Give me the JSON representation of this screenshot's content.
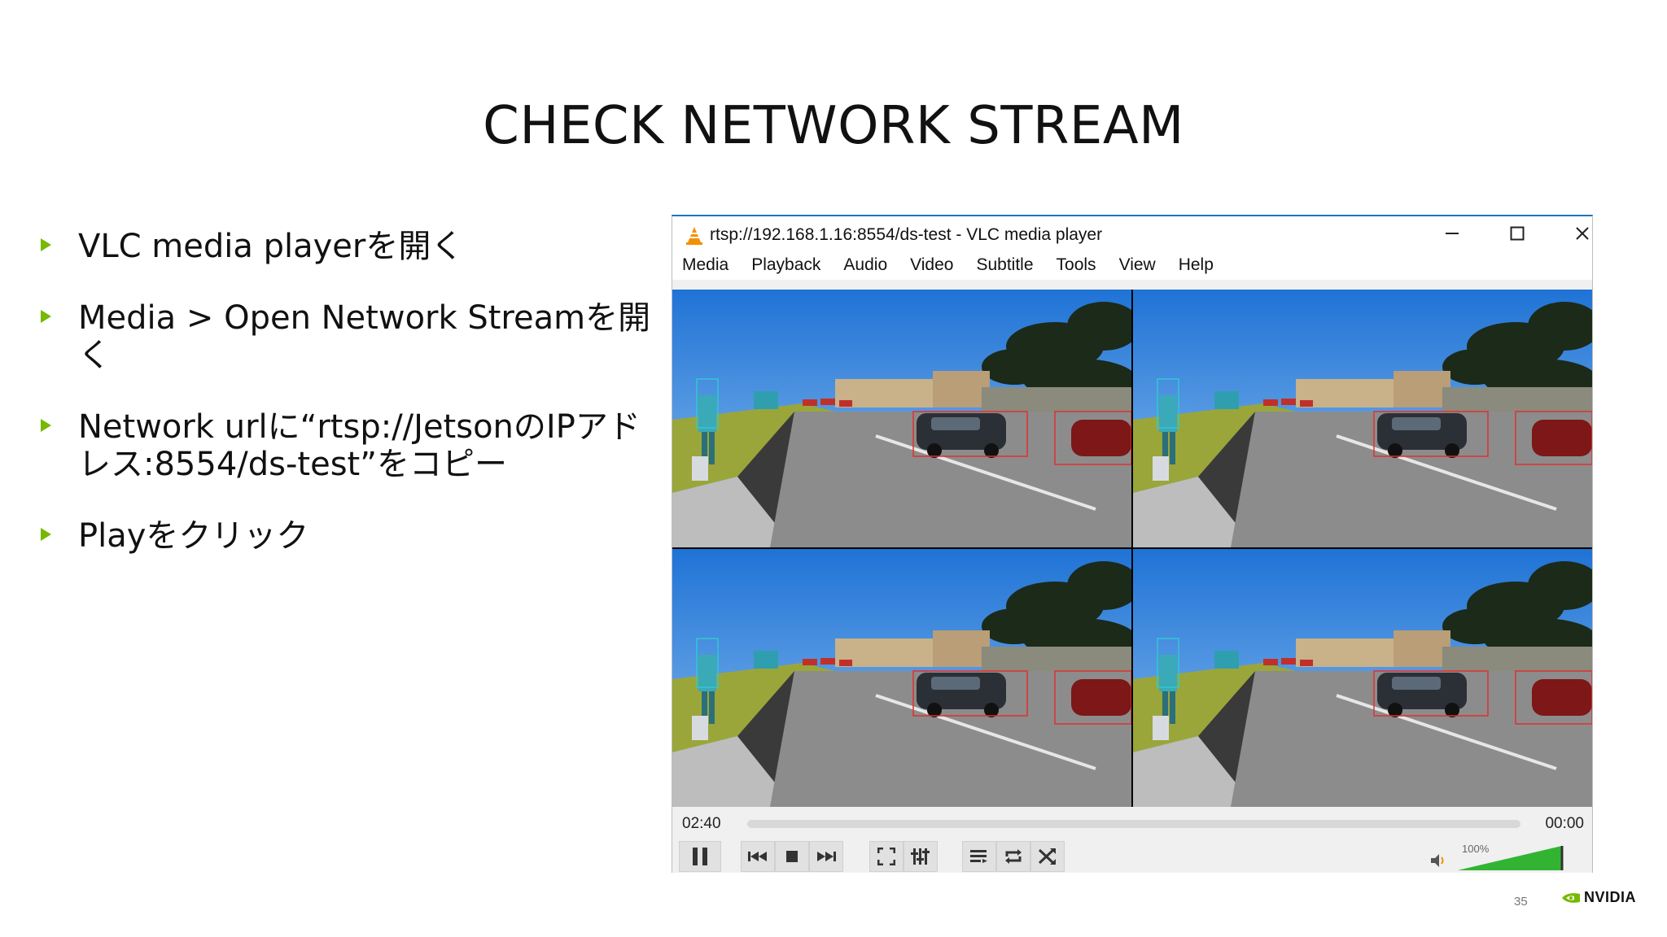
{
  "slide": {
    "title": "CHECK NETWORK STREAM",
    "bullets": [
      "VLC media playerを開く",
      "Media > Open Network Streamを開く",
      "Network urlに“rtsp://JetsonのIPアドレス:8554/ds-test”をコピー",
      "Playをクリック"
    ],
    "page_number": "35",
    "logo_text": "NVIDIA",
    "accent_color": "#76b900"
  },
  "vlc": {
    "window_title": "rtsp://192.168.1.16:8554/ds-test - VLC media player",
    "menu": [
      "Media",
      "Playback",
      "Audio",
      "Video",
      "Subtitle",
      "Tools",
      "View",
      "Help"
    ],
    "elapsed": "02:40",
    "remaining": "00:00",
    "volume": "100%",
    "playback_progress": 0.0,
    "icons": [
      "vlc-cone-icon",
      "minimize-icon",
      "maximize-icon",
      "close-icon",
      "pause-icon",
      "previous-icon",
      "stop-icon",
      "next-icon",
      "fullscreen-icon",
      "extended-settings-icon",
      "playlist-icon",
      "loop-icon",
      "shuffle-icon",
      "volume-icon"
    ]
  }
}
